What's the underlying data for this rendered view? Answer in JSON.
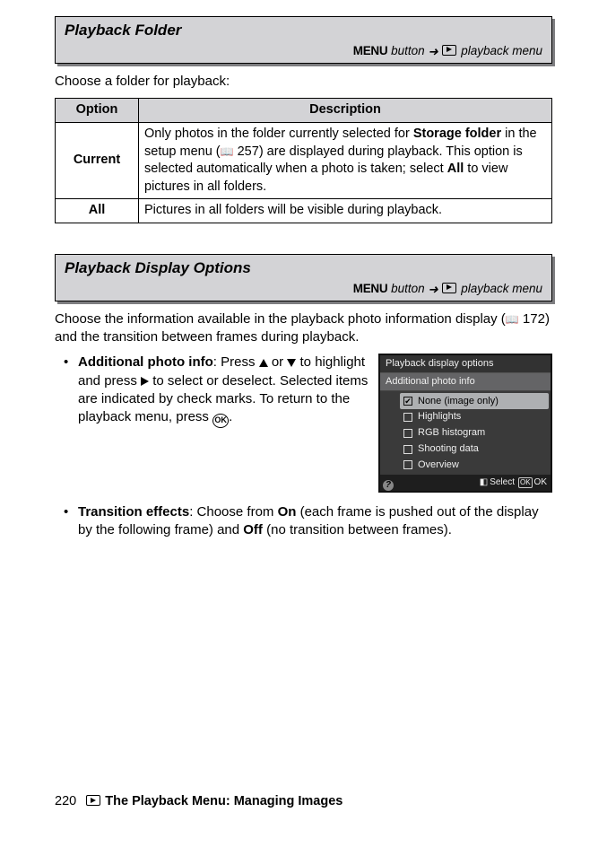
{
  "section1": {
    "title": "Playback Folder",
    "crumb_menu": "MENU",
    "crumb_button_word": " button  ",
    "crumb_arrow": "➜",
    "crumb_target": " playback menu",
    "intro": "Choose a folder for playback:"
  },
  "table": {
    "head_option": "Option",
    "head_desc": "Description",
    "row1_key": "Current",
    "row1_pre": "Only photos in the folder currently selected for ",
    "row1_bold1": "Storage folder",
    "row1_mid1": " in the setup menu (",
    "row1_ref": " 257) are displayed during playback.  This option is selected automatically when a photo is taken; select ",
    "row1_bold2": "All",
    "row1_post": " to view pictures in all folders.",
    "row2_key": "All",
    "row2_desc": "Pictures in all folders will be visible during playback."
  },
  "section2": {
    "title": "Playback Display Options",
    "crumb_menu": "MENU",
    "crumb_button_word": " button  ",
    "crumb_arrow": "➜",
    "crumb_target": " playback menu",
    "intro_pre": "Choose the information available in the playback photo information display (",
    "intro_ref": " 172) and the transition between frames during playback."
  },
  "bullet1": {
    "title": "Additional photo info",
    "t1": ": Press ",
    "t2": " or ",
    "t3": " to highlight and press ",
    "t4": " to select or deselect.  Selected items are indicated by check marks.  To return to the playback menu, press ",
    "t5": "."
  },
  "lcd": {
    "h1": "Playback display options",
    "h2": "Additional photo info",
    "r1": "None (image only)",
    "r2": "Highlights",
    "r3": "RGB histogram",
    "r4": "Shooting data",
    "r5": "Overview",
    "sel": "Select",
    "ok": "OK"
  },
  "bullet2": {
    "title": "Transition effects",
    "t1": ": Choose from ",
    "b1": "On",
    "t2": " (each frame is pushed out of the display by the following frame) and ",
    "b2": "Off",
    "t3": " (no transition between frames)."
  },
  "footer": {
    "page": "220",
    "title": "The Playback Menu: Managing Images"
  }
}
